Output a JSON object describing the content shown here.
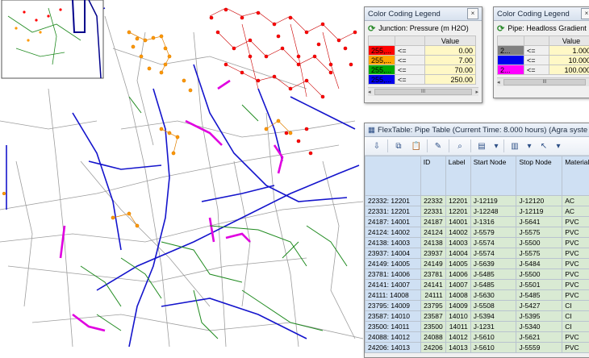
{
  "legend_pressure": {
    "title": "Color Coding Legend",
    "close": "×",
    "field": "Junction: Pressure (m H2O)",
    "value_header": "Value",
    "rows": [
      {
        "label": "255,...",
        "op": "<=",
        "value": "0.00",
        "color": "#ff0000"
      },
      {
        "label": "255,...",
        "op": "<=",
        "value": "7.00",
        "color": "#ffa500"
      },
      {
        "label": "255,...",
        "op": "<=",
        "value": "70.00",
        "color": "#00aa00"
      },
      {
        "label": "255,...",
        "op": "<=",
        "value": "250.00",
        "color": "#0000ee"
      }
    ],
    "scroll_thumb": "III"
  },
  "legend_pipe": {
    "title": "Color Coding Legend",
    "close": "×",
    "field": "Pipe: Headloss Gradient",
    "value_header": "Value",
    "rows": [
      {
        "label": "2...",
        "op": "<=",
        "value": "1.000",
        "color": "#808080"
      },
      {
        "label": "",
        "op": "<=",
        "value": "10.000",
        "color": "#0000ee"
      },
      {
        "label": "2...",
        "op": "<=",
        "value": "100.000",
        "color": "#ff00ff"
      }
    ],
    "scroll_thumb": "III"
  },
  "flextable": {
    "title": "FlexTable: Pipe Table (Current Time:  8.000 hours) (Agra syste",
    "columns": [
      "",
      "ID",
      "Label",
      "Start Node",
      "Stop Node",
      "Material"
    ],
    "rows": [
      [
        "22332: 12201",
        "22332",
        "12201",
        "J-12119",
        "J-12120",
        "AC"
      ],
      [
        "22331: 12201",
        "22331",
        "12201",
        "J-12248",
        "J-12119",
        "AC"
      ],
      [
        "24187: 14001",
        "24187",
        "14001",
        "J-1316",
        "J-5641",
        "PVC"
      ],
      [
        "24124: 14002",
        "24124",
        "14002",
        "J-5579",
        "J-5575",
        "PVC"
      ],
      [
        "24138: 14003",
        "24138",
        "14003",
        "J-5574",
        "J-5500",
        "PVC"
      ],
      [
        "23937: 14004",
        "23937",
        "14004",
        "J-5574",
        "J-5575",
        "PVC"
      ],
      [
        "24149: 14005",
        "24149",
        "14005",
        "J-5639",
        "J-5484",
        "PVC"
      ],
      [
        "23781: 14006",
        "23781",
        "14006",
        "J-5485",
        "J-5500",
        "PVC"
      ],
      [
        "24141: 14007",
        "24141",
        "14007",
        "J-5485",
        "J-5501",
        "PVC"
      ],
      [
        "24111: 14008",
        "24111",
        "14008",
        "J-5630",
        "J-5485",
        "PVC"
      ],
      [
        "23795: 14009",
        "23795",
        "14009",
        "J-5508",
        "J-5427",
        "CI"
      ],
      [
        "23587: 14010",
        "23587",
        "14010",
        "J-5394",
        "J-5395",
        "CI"
      ],
      [
        "23500: 14011",
        "23500",
        "14011",
        "J-1231",
        "J-5340",
        "CI"
      ],
      [
        "24088: 14012",
        "24088",
        "14012",
        "J-5610",
        "J-5621",
        "PVC"
      ],
      [
        "24206: 14013",
        "24206",
        "14013",
        "J-5610",
        "J-5559",
        "PVC"
      ]
    ]
  }
}
